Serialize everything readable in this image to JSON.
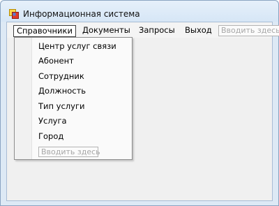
{
  "window": {
    "title": "Информационная система"
  },
  "menubar": {
    "items": [
      {
        "label": "Справочники"
      },
      {
        "label": "Документы"
      },
      {
        "label": "Запросы"
      },
      {
        "label": "Выход"
      }
    ],
    "input_placeholder": "Вводить здесь"
  },
  "dropdown": {
    "items": [
      {
        "label": "Центр услуг связи"
      },
      {
        "label": "Абонент"
      },
      {
        "label": "Сотрудник"
      },
      {
        "label": "Должность"
      },
      {
        "label": "Тип услуги"
      },
      {
        "label": "Услуга"
      },
      {
        "label": "Город"
      }
    ],
    "input_placeholder": "Вводить здесь"
  },
  "icons": {
    "app": "app-window-icon"
  },
  "colors": {
    "active_border": "#3c3c3c",
    "placeholder_text": "#a7a7a7"
  }
}
